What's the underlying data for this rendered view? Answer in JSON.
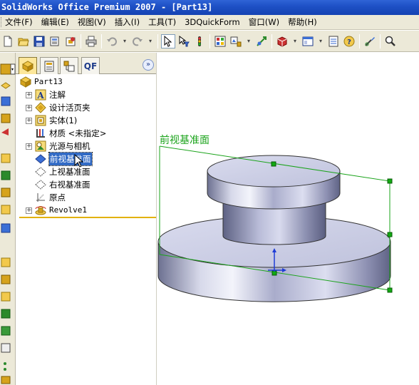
{
  "window": {
    "title": "SolidWorks Office Premium 2007 - [Part13]"
  },
  "menu": {
    "items": [
      "文件(F)",
      "编辑(E)",
      "视图(V)",
      "插入(I)",
      "工具(T)",
      "3DQuickForm",
      "窗口(W)",
      "帮助(H)"
    ]
  },
  "toolbar": {
    "icons": [
      "new-icon",
      "open-icon",
      "save-icon",
      "print-preview-icon",
      "options-icon",
      "print-icon",
      "undo-icon",
      "redo-icon",
      "select-icon",
      "select-filter-icon",
      "rebuild-icon",
      "grid-icon",
      "zoom-to-fit-icon",
      "smart-dimension-icon",
      "view-orientation-icon",
      "display-style-icon",
      "properties-icon",
      "help-icon",
      "sketch-icon",
      "zoom-icon"
    ]
  },
  "feature_manager": {
    "tabs": [
      "feature-manager-tab",
      "property-manager-tab",
      "configuration-manager-tab",
      "QF"
    ],
    "root": "Part13",
    "items": [
      {
        "label": "注解",
        "expandable": true
      },
      {
        "label": "设计活页夹",
        "expandable": true
      },
      {
        "label": "实体(1)",
        "expandable": true
      },
      {
        "label": "材质 <未指定>",
        "expandable": false
      },
      {
        "label": "光源与相机",
        "expandable": true
      },
      {
        "label": "前视基准面",
        "expandable": false,
        "selected": true
      },
      {
        "label": "上视基准面",
        "expandable": false
      },
      {
        "label": "右视基准面",
        "expandable": false
      },
      {
        "label": "原点",
        "expandable": false
      },
      {
        "label": "Revolve1",
        "expandable": true
      }
    ]
  },
  "graphics": {
    "plane_label": "前视基准面",
    "plane_color": "#1aa31a",
    "selection_handle_color": "#11aa11",
    "part_color": "#c9cce2"
  }
}
